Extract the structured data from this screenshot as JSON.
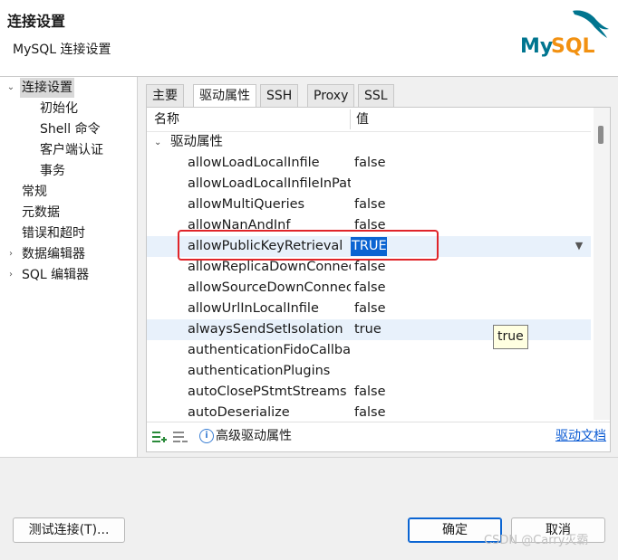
{
  "header": {
    "title": "连接设置",
    "subtitle": "MySQL 连接设置",
    "logo_text": "MySQL",
    "colors": {
      "logo_blue": "#00758f",
      "logo_orange": "#f29111"
    }
  },
  "tree": {
    "items": [
      {
        "label": "连接设置",
        "expanded": true,
        "selected": true
      },
      {
        "label": "初始化"
      },
      {
        "label": "Shell 命令"
      },
      {
        "label": "客户端认证"
      },
      {
        "label": "事务"
      },
      {
        "label": "常规"
      },
      {
        "label": "元数据"
      },
      {
        "label": "错误和超时"
      },
      {
        "label": "数据编辑器",
        "expandable": true
      },
      {
        "label": "SQL 编辑器",
        "expandable": true
      }
    ]
  },
  "tabs": [
    {
      "label": "主要"
    },
    {
      "label": "驱动属性",
      "active": true
    },
    {
      "label": "SSH"
    },
    {
      "label": "Proxy"
    },
    {
      "label": "SSL"
    }
  ],
  "grid": {
    "columns": {
      "name": "名称",
      "value": "值"
    },
    "group": "驱动属性",
    "rows": [
      {
        "name": "allowLoadLocalInfile",
        "value": "false"
      },
      {
        "name": "allowLoadLocalInfileInPath",
        "value": ""
      },
      {
        "name": "allowMultiQueries",
        "value": "false"
      },
      {
        "name": "allowNanAndInf",
        "value": "false"
      },
      {
        "name": "allowPublicKeyRetrieval",
        "value": "TRUE",
        "editing": true
      },
      {
        "name": "allowReplicaDownConnections",
        "value": "false"
      },
      {
        "name": "allowSourceDownConnections",
        "value": "false"
      },
      {
        "name": "allowUrlInLocalInfile",
        "value": "false"
      },
      {
        "name": "alwaysSendSetIsolation",
        "value": "true",
        "highlighted": true
      },
      {
        "name": "authenticationFidoCallbackHandler",
        "value": ""
      },
      {
        "name": "authenticationPlugins",
        "value": ""
      },
      {
        "name": "autoClosePStmtStreams",
        "value": "false"
      },
      {
        "name": "autoDeserialize",
        "value": "false"
      }
    ],
    "tooltip": "true"
  },
  "footer": {
    "advanced_label": "高级驱动属性",
    "doc_link": "驱动文档"
  },
  "buttons": {
    "test": "测试连接(T)...",
    "ok": "确定",
    "cancel": "取消"
  },
  "watermark": "CSDN @Carry灭霸"
}
